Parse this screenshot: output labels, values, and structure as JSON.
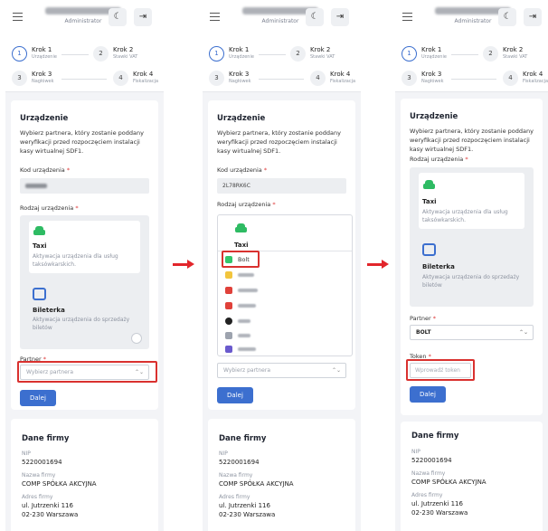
{
  "header": {
    "user_role": "Administrator",
    "moon_icon": "moon-icon",
    "logout_icon": "logout-icon"
  },
  "steps": [
    {
      "num": "1",
      "title": "Krok 1",
      "sub": "Urządzenie"
    },
    {
      "num": "2",
      "title": "Krok 2",
      "sub": "Stawki VAT"
    },
    {
      "num": "3",
      "title": "Krok 3",
      "sub": "Nagłówek"
    },
    {
      "num": "4",
      "title": "Krok 4",
      "sub": "Fiskalizacja"
    }
  ],
  "device": {
    "title": "Urządzenie",
    "intro": "Wybierz partnera, który zostanie poddany weryfikacji przed rozpoczęciem instalacji kasy wirtualnej SDF1.",
    "code_label": "Kod urządzenia",
    "code_value": "2L78RK6C",
    "type_label": "Rodzaj urządzenia",
    "taxi_title": "Taxi",
    "taxi_desc": "Aktywacja urządzenia dla usług taksówkarskich.",
    "bileterka_title": "Bileterka",
    "bileterka_desc": "Aktywacja urządzenia do sprzedaży biletów",
    "partner_label": "Partner",
    "partner_placeholder": "Wybierz partnera",
    "partner_selected": "BOLT",
    "token_label": "Token",
    "token_placeholder": "Wprowadź token",
    "next_button": "Dalej",
    "required_mark": "*"
  },
  "dropdown": {
    "selected_item": "Bolt"
  },
  "company": {
    "title": "Dane firmy",
    "nip_label": "NIP",
    "nip": "5220001694",
    "name_label": "Nazwa firmy",
    "name": "COMP SPÓŁKA AKCYJNA",
    "address_label": "Adres firmy",
    "street": "ul. Jutrzenki 116",
    "city": "02-230 Warszawa"
  },
  "colors": {
    "accent": "#3c6fcf",
    "highlight": "#d9312f",
    "arrow": "#e2262b",
    "taxi": "#2ebb63"
  }
}
